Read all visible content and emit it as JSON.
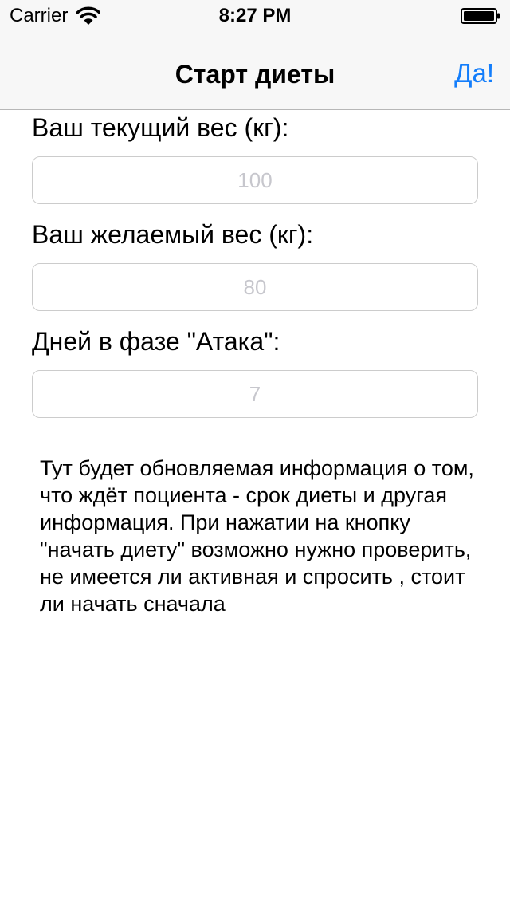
{
  "status_bar": {
    "carrier": "Carrier",
    "time": "8:27 PM",
    "icons": [
      "wifi-icon",
      "battery-icon"
    ]
  },
  "nav_bar": {
    "title": "Старт диеты",
    "action_label": "Да!",
    "action_color": "#147efb"
  },
  "form": {
    "current_weight": {
      "label": "Ваш текущий вес (кг):",
      "value": "",
      "placeholder": "100"
    },
    "target_weight": {
      "label": "Ваш желаемый вес (кг):",
      "value": "",
      "placeholder": "80"
    },
    "attack_days": {
      "label": "Дней в фазе \"Атака\":",
      "value": "",
      "placeholder": "7"
    }
  },
  "info_text": "Тут будет обновляемая информация о том, что ждёт поциента - срок диеты и другая информация. При нажатии на кнопку \"начать диету\" возможно нужно проверить, не имеется ли активная и спросить , стоит ли начать сначала"
}
